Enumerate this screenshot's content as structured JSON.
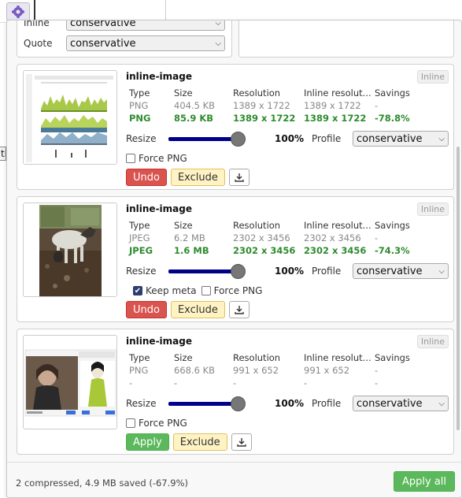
{
  "settings": {
    "inline_label": "Inline",
    "inline_value": "conservative",
    "quote_label": "Quote",
    "quote_value": "conservative"
  },
  "table_headers": {
    "type": "Type",
    "size": "Size",
    "resolution": "Resolution",
    "inline_resolution": "Inline resolut...",
    "savings": "Savings"
  },
  "labels": {
    "resize": "Resize",
    "profile": "Profile",
    "force_png": "Force PNG",
    "keep_meta": "Keep meta",
    "undo": "Undo",
    "apply": "Apply",
    "exclude": "Exclude",
    "inline_badge": "Inline"
  },
  "images": [
    {
      "title": "inline-image",
      "orig": {
        "type": "PNG",
        "size": "404.5 KB",
        "resolution": "1389 x 1722",
        "inline_resolution": "1389 x 1722",
        "savings": "-"
      },
      "comp": {
        "type": "PNG",
        "size": "85.9 KB",
        "resolution": "1389 x 1722",
        "inline_resolution": "1389 x 1722",
        "savings": "-78.8%"
      },
      "resize_pct": "100%",
      "profile": "conservative"
    },
    {
      "title": "inline-image",
      "orig": {
        "type": "JPEG",
        "size": "6.2 MB",
        "resolution": "2302 x 3456",
        "inline_resolution": "2302 x 3456",
        "savings": "-"
      },
      "comp": {
        "type": "JPEG",
        "size": "1.6 MB",
        "resolution": "2302 x 3456",
        "inline_resolution": "2302 x 3456",
        "savings": "-74.3%"
      },
      "resize_pct": "100%",
      "profile": "conservative"
    },
    {
      "title": "inline-image",
      "orig": {
        "type": "PNG",
        "size": "668.6 KB",
        "resolution": "991 x 652",
        "inline_resolution": "991 x 652",
        "savings": "-"
      },
      "comp": {
        "type": "-",
        "size": "-",
        "resolution": "-",
        "inline_resolution": "-",
        "savings": "-"
      },
      "resize_pct": "100%",
      "profile": "conservative"
    }
  ],
  "footer": {
    "summary": "2 compressed, 4.9 MB saved (-67.9%)",
    "apply_all": "Apply all"
  },
  "background": {
    "partial_text": "th"
  },
  "colors": {
    "undo": "#d9534f",
    "apply": "#5cb85c",
    "exclude": "#fff3c4",
    "savings_green": "#2e8b2e",
    "slider": "#00008b"
  }
}
